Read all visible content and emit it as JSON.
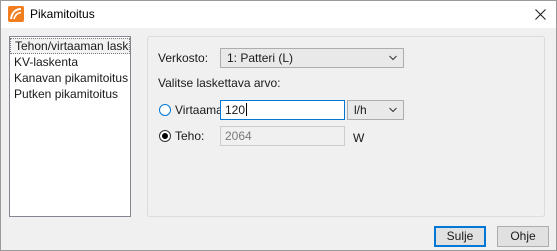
{
  "window": {
    "title": "Pikamitoitus"
  },
  "sidebar": {
    "items": [
      {
        "label": "Tehon/virtaaman laskenta",
        "selected": true
      },
      {
        "label": "KV-laskenta"
      },
      {
        "label": "Kanavan pikamitoitus"
      },
      {
        "label": "Putken pikamitoitus"
      }
    ]
  },
  "form": {
    "network_label": "Verkosto:",
    "network_value": "1: Patteri (L)",
    "choose_label": "Valitse laskettava arvo:",
    "flow_label": "Virtaama:",
    "flow_value": "120",
    "flow_unit": "l/h",
    "flow_selected": false,
    "power_label": "Teho:",
    "power_value": "2064",
    "power_unit": "W",
    "power_selected": true
  },
  "buttons": {
    "close_label": "Sulje",
    "help_label": "Ohje"
  },
  "colors": {
    "accent": "#0078d7",
    "icon_orange": "#f07d1e"
  },
  "icons": {
    "app": "pikamitoitus-app-icon",
    "close": "close-icon",
    "dropdown": "chevron-down-icon"
  }
}
